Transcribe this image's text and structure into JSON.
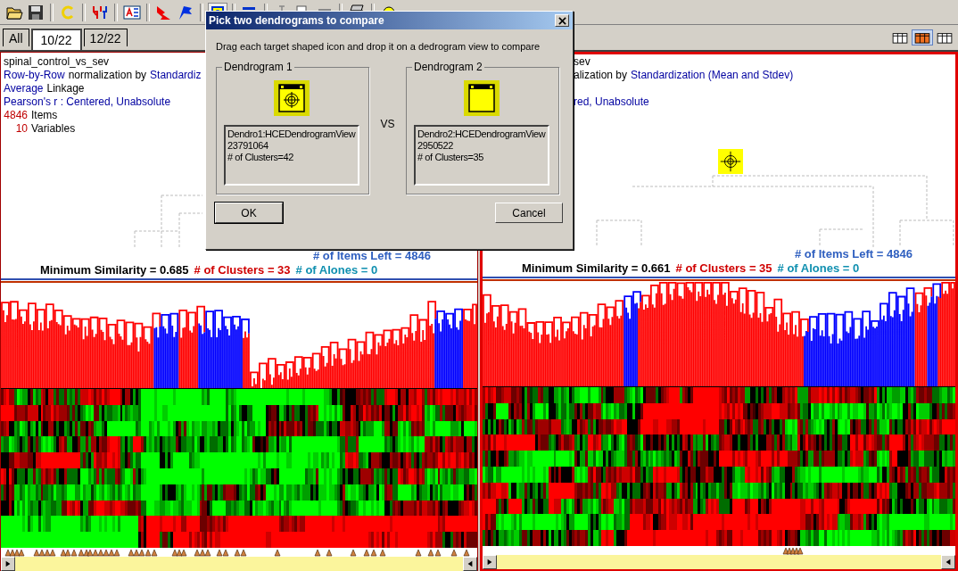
{
  "tabs": [
    {
      "label": "All",
      "selected": false
    },
    {
      "label": "10/22",
      "selected": true
    },
    {
      "label": "12/22",
      "selected": false
    }
  ],
  "view_layouts": [
    {
      "selected": false
    },
    {
      "selected": true
    },
    {
      "selected": false
    }
  ],
  "panels": [
    {
      "active": false,
      "info": [
        {
          "kind": "text",
          "parts": [
            {
              "kind": "plain",
              "text": "spinal_control_vs_sev"
            }
          ]
        },
        {
          "kind": "text",
          "parts": [
            {
              "kind": "param",
              "text": "Row-by-Row"
            },
            {
              "kind": "plain",
              "text": "normalization by"
            },
            {
              "kind": "param",
              "text": "Standardiz"
            }
          ]
        },
        {
          "kind": "text",
          "parts": [
            {
              "kind": "param",
              "text": "Average"
            },
            {
              "kind": "plain",
              "text": "Linkage"
            }
          ]
        },
        {
          "kind": "text",
          "parts": [
            {
              "kind": "param",
              "text": "Pearson's r : Centered, Unabsolute"
            }
          ]
        },
        {
          "kind": "text",
          "parts": [
            {
              "kind": "count",
              "text": "4846"
            },
            {
              "kind": "plain",
              "text": "Items"
            }
          ]
        },
        {
          "kind": "text",
          "parts": [
            {
              "kind": "count",
              "text": "10"
            },
            {
              "kind": "plain",
              "text": "Variables"
            }
          ]
        }
      ],
      "items_left": "# of Items Left = 4846",
      "min_similarity": "Minimum Similarity = 0.685",
      "clusters": "# of Clusters = 33",
      "alones": "# of Alones = 0"
    },
    {
      "active": true,
      "target_marker": true,
      "info": [
        {
          "kind": "text",
          "parts": [
            {
              "kind": "plain",
              "text": "sev"
            }
          ]
        },
        {
          "kind": "text",
          "parts": [
            {
              "kind": "plain",
              "text": "alization by"
            },
            {
              "kind": "param",
              "text": "Standardization (Mean and Stdev)"
            }
          ]
        },
        {
          "kind": "covered"
        },
        {
          "kind": "text",
          "parts": [
            {
              "kind": "param",
              "text": "red, Unabsolute"
            }
          ]
        }
      ],
      "items_left": "# of Items Left = 4846",
      "min_similarity": "Minimum Similarity = 0.661",
      "clusters": "# of Clusters = 35",
      "alones": "# of Alones = 0"
    }
  ],
  "dialog": {
    "title": "Pick two dendrograms to compare",
    "instruction": "Drag each target shaped icon and drop it on a dedrogram view to compare",
    "vs": "VS",
    "groups": [
      {
        "legend": "Dendrogram 1",
        "target": true,
        "lines": [
          "Dendro1:HCEDendrogramView",
          "23791064",
          "# of Clusters=42"
        ]
      },
      {
        "legend": "Dendrogram 2",
        "target": false,
        "lines": [
          "Dendro2:HCEDendrogramView",
          "2950522",
          "# of Clusters=35"
        ]
      }
    ],
    "buttons": [
      {
        "label": "OK",
        "default": true
      },
      {
        "label": "Cancel",
        "default": false
      }
    ]
  }
}
